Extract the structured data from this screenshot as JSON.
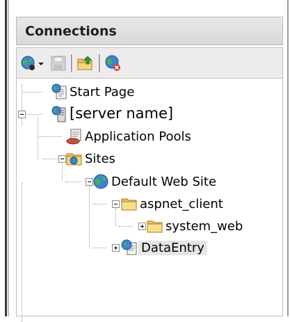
{
  "header": {
    "title": "Connections"
  },
  "toolbar": {
    "buttons": [
      {
        "icon": "connect-globe-icon"
      },
      {
        "icon": "dropdown-arrow-icon"
      },
      {
        "icon": "save-icon"
      },
      {
        "icon": "up-folder-icon"
      },
      {
        "icon": "disconnect-icon"
      }
    ]
  },
  "tree": {
    "start_page": "Start Page",
    "server": "[server name]",
    "app_pools": "Application Pools",
    "sites": "Sites",
    "default_site": "Default Web Site",
    "aspnet_client": "aspnet_client",
    "system_web": "system_web",
    "data_entry": "DataEntry"
  },
  "colors": {
    "selection": "#e6e6e6",
    "header_bg": "#dddddd",
    "folder": "#f2d36b",
    "globe": "#2d79c7"
  }
}
